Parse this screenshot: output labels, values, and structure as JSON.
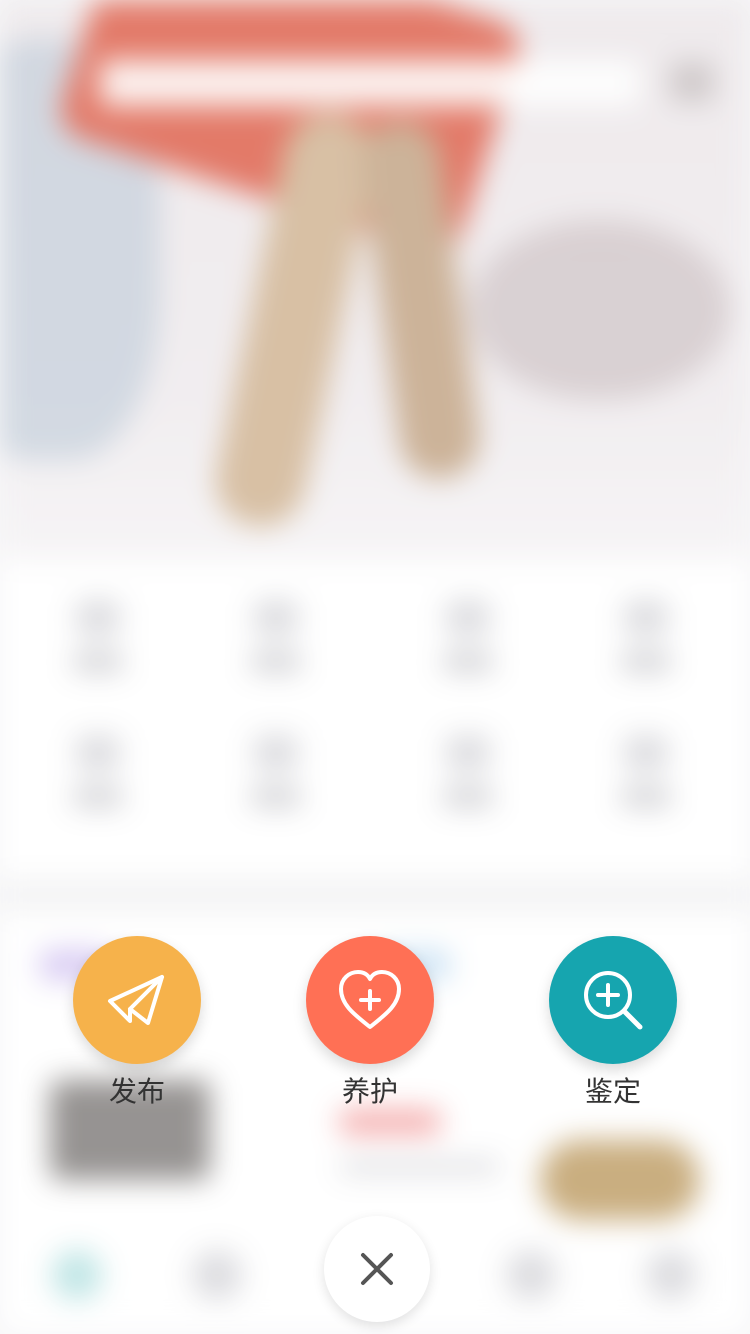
{
  "actions": [
    {
      "label": "发布",
      "icon": "paper-plane-icon",
      "color": "#F6B24B"
    },
    {
      "label": "养护",
      "icon": "heart-plus-icon",
      "color": "#FF7055"
    },
    {
      "label": "鉴定",
      "icon": "zoom-in-icon",
      "color": "#16A5AF"
    }
  ],
  "close": {
    "icon": "close-icon"
  }
}
